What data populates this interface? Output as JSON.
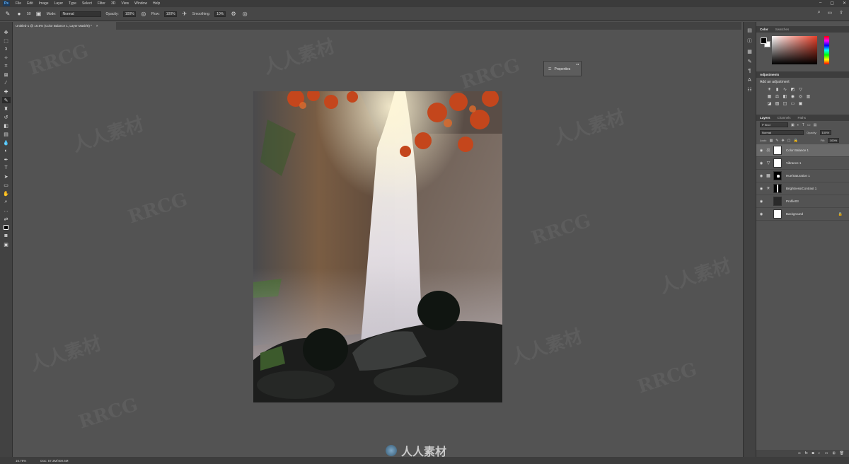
{
  "menubar": {
    "logo": "Ps",
    "items": [
      "File",
      "Edit",
      "Image",
      "Layer",
      "Type",
      "Select",
      "Filter",
      "3D",
      "View",
      "Window",
      "Help"
    ]
  },
  "optionsbar": {
    "brush_size": "50",
    "mode_label": "Mode:",
    "mode_value": "Normal",
    "opacity_label": "Opacity:",
    "opacity_value": "100%",
    "flow_label": "Flow:",
    "flow_value": "100%",
    "smoothing_label": "Smoothing:",
    "smoothing_value": "10%"
  },
  "document": {
    "tab_title": "Untitled-1 @ 16.6% (Color Balance 1, Layer Mask/8) *",
    "close": "×"
  },
  "properties": {
    "label": "Properties"
  },
  "statusbar": {
    "zoom": "16.78%",
    "doc": "Doc: 57.3M/400.6M"
  },
  "panels": {
    "color_tabs": [
      "Color",
      "Swatches"
    ],
    "adjustments_tab": "Adjustments",
    "adjustments_title": "Add an adjustment",
    "layers_tabs": [
      "Layers",
      "Channels",
      "Paths"
    ],
    "kind_label": "P Kind",
    "blend_mode": "Normal",
    "opacity_label": "Opacity:",
    "opacity_value": "100%",
    "lock_label": "Lock:",
    "fill_label": "Fill:",
    "fill_value": "100%",
    "layers": [
      {
        "name": "Color Balance 1",
        "selected": true
      },
      {
        "name": "Vibrance 1",
        "selected": false
      },
      {
        "name": "Hue/Saturation 1",
        "selected": false
      },
      {
        "name": "Brightness/Contrast 1",
        "selected": false
      },
      {
        "name": "Profile03",
        "selected": false
      },
      {
        "name": "Background",
        "selected": false
      }
    ]
  },
  "watermarks": {
    "latin": "RRCG",
    "cn": "人人素材"
  },
  "colors": {
    "accent": "#e8402a",
    "chrome_dark": "#3b3b3b",
    "canvas_bg": "#535353"
  }
}
